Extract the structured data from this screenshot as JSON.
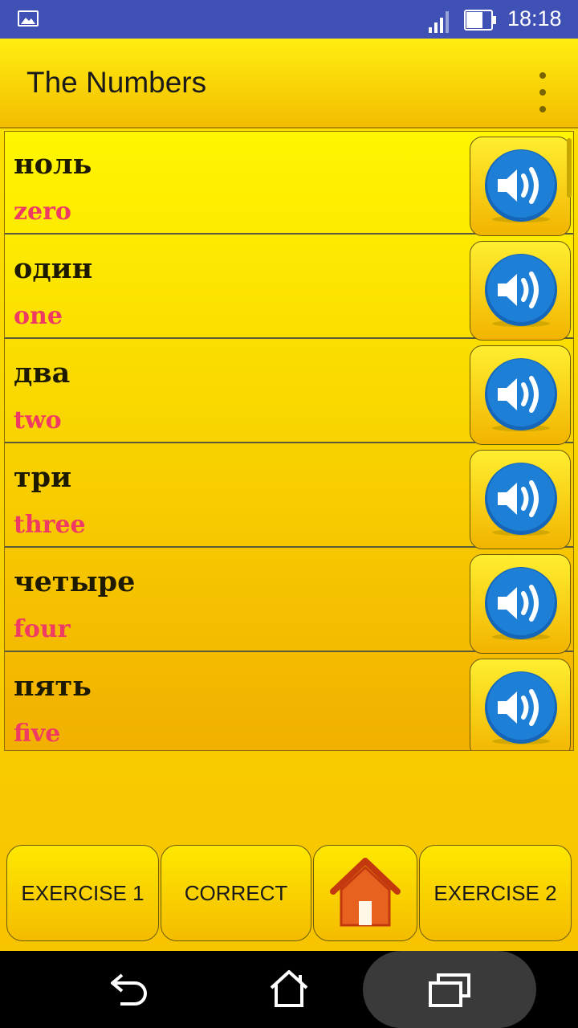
{
  "status_bar": {
    "time": "18:18",
    "icons": [
      "gallery-icon",
      "signal-icon",
      "battery-icon"
    ],
    "color": "#3f51b5"
  },
  "app_bar": {
    "title": "The Numbers",
    "menu_icon": "overflow-menu-icon"
  },
  "items": [
    {
      "word": "ноль",
      "translation": "zero"
    },
    {
      "word": "один",
      "translation": "one"
    },
    {
      "word": "два",
      "translation": "two"
    },
    {
      "word": "три",
      "translation": "three"
    },
    {
      "word": "четыре",
      "translation": "four"
    },
    {
      "word": "пять",
      "translation": "five"
    }
  ],
  "bottom_buttons": {
    "exercise1": "EXERCISE 1",
    "correct": "CORRECT",
    "home_icon": "home-icon",
    "exercise2": "EXERCISE 2"
  },
  "nav_bar": {
    "icons": [
      "back-icon",
      "home-nav-icon",
      "recent-apps-icon"
    ]
  },
  "colors": {
    "background": "#fde400",
    "translation": "#ef3a64",
    "speaker": "#1976c8"
  }
}
